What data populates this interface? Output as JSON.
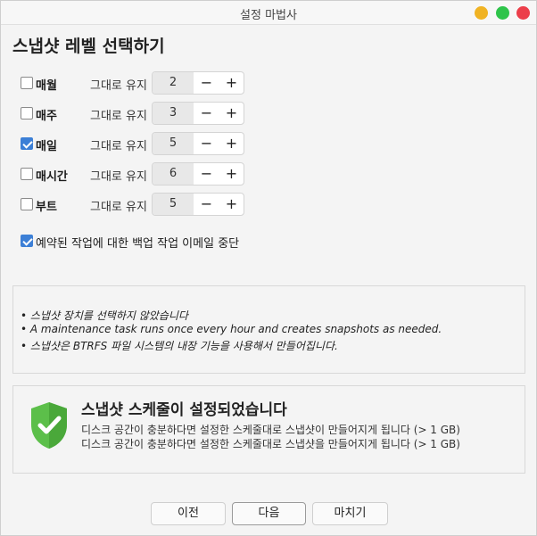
{
  "window": {
    "title": "설정 마법사"
  },
  "heading": "스냅샷 레벨 선택하기",
  "levels": [
    {
      "label": "매월",
      "checked": false,
      "keep_label": "그대로 유지",
      "value": "2"
    },
    {
      "label": "매주",
      "checked": false,
      "keep_label": "그대로 유지",
      "value": "3"
    },
    {
      "label": "매일",
      "checked": true,
      "keep_label": "그대로 유지",
      "value": "5"
    },
    {
      "label": "매시간",
      "checked": false,
      "keep_label": "그대로 유지",
      "value": "6"
    },
    {
      "label": "부트",
      "checked": false,
      "keep_label": "그대로 유지",
      "value": "5"
    }
  ],
  "spin": {
    "minus": "−",
    "plus": "+"
  },
  "email_option": {
    "label": "예약된 작업에 대한 백업 작업 이메일 중단",
    "checked": true
  },
  "info": {
    "lines": [
      "• 스냅샷 장치를 선택하지 않았습니다",
      "• A maintenance task runs once every hour and creates snapshots as needed.",
      "• 스냅샷은 BTRFS 파일 시스템의 내장 기능을 사용해서 만들어집니다."
    ]
  },
  "status": {
    "title": "스냅샷 스케줄이 설정되었습니다",
    "line1": "디스크 공간이 충분하다면 설정한 스케줄대로 스냅샷이 만들어지게 됩니다 (> 1 GB)",
    "line2": "디스크 공간이 충분하다면 설정한 스케줄대로 스냅샷을 만들어지게 됩니다 (> 1 GB)",
    "icon": "shield-check-icon",
    "icon_color": "#5cbf4a"
  },
  "buttons": {
    "prev": "이전",
    "next": "다음",
    "finish": "마치기"
  },
  "colors": {
    "accent": "#3c7fd6",
    "minimize": "#f0b324",
    "maximize": "#2ec44a",
    "close": "#ec3f4a"
  }
}
